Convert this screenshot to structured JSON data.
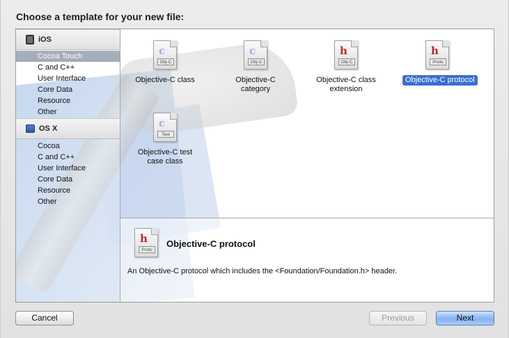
{
  "dialog": {
    "heading": "Choose a template for your new file:"
  },
  "sidebar": {
    "ios": {
      "title": "iOS",
      "items": [
        "Cocoa Touch",
        "C and C++",
        "User Interface",
        "Core Data",
        "Resource",
        "Other"
      ],
      "selected_index": 0
    },
    "osx": {
      "title": "OS X",
      "items": [
        "Cocoa",
        "C and C++",
        "User Interface",
        "Core Data",
        "Resource",
        "Other"
      ]
    }
  },
  "templates": [
    {
      "label": "Objective-C class",
      "icon_tag": "Obj-C",
      "glyph": "c"
    },
    {
      "label": "Objective-C\ncategory",
      "icon_tag": "Obj-C",
      "glyph": "c"
    },
    {
      "label": "Objective-C class\nextension",
      "icon_tag": "Obj-C",
      "glyph": "h"
    },
    {
      "label": "Objective-C protocol",
      "icon_tag": "Proto",
      "glyph": "h",
      "selected": true
    },
    {
      "label": "Objective-C test\ncase class",
      "icon_tag": "Test",
      "glyph": "c"
    }
  ],
  "description": {
    "title": "Objective-C protocol",
    "icon_tag": "Proto",
    "glyph": "h",
    "text": "An Objective-C protocol which includes the <Foundation/Foundation.h> header."
  },
  "buttons": {
    "cancel": "Cancel",
    "previous": "Previous",
    "next": "Next"
  },
  "colors": {
    "selection": "#3a6fd2",
    "primary_button": "#87b2ee",
    "sidebar_selection": "#a6adbb"
  }
}
